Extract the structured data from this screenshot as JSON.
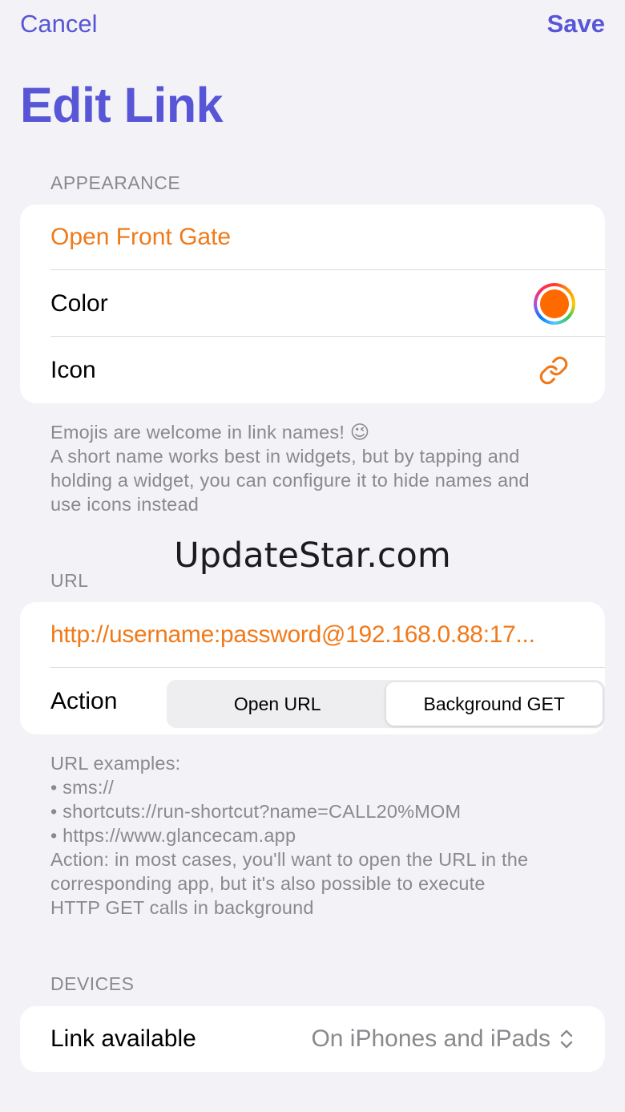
{
  "nav": {
    "cancel_label": "Cancel",
    "save_label": "Save"
  },
  "page_title": "Edit Link",
  "appearance": {
    "header": "APPEARANCE",
    "name_value": "Open Front Gate",
    "color_label": "Color",
    "color_value": "#ff6a00",
    "icon_label": "Icon",
    "icon_name": "link-icon",
    "footer_lines": [
      "Emojis are welcome in link names! 😉",
      "A short name works best in widgets, but by tapping and",
      "holding a widget, you can configure it to hide names and",
      "use icons instead"
    ]
  },
  "watermark": "UpdateStar.com",
  "url_section": {
    "header": "URL",
    "url_value": "http://username:password@192.168.0.88:17...",
    "action_label": "Action",
    "action_options": [
      "Open URL",
      "Background GET"
    ],
    "action_selected": "Background GET",
    "footer_lines": [
      "URL examples:",
      "• sms://",
      "• shortcuts://run-shortcut?name=CALL20%MOM",
      "• https://www.glancecam.app",
      "Action: in most cases, you'll want to open the URL in the",
      "corresponding app, but it's also possible to execute",
      "HTTP GET calls in background"
    ]
  },
  "devices": {
    "header": "DEVICES",
    "link_available_label": "Link available",
    "link_available_value": "On iPhones and iPads"
  },
  "colors": {
    "accent": "#5856d6",
    "orange": "#f07a1a",
    "background": "#f2f2f7"
  }
}
